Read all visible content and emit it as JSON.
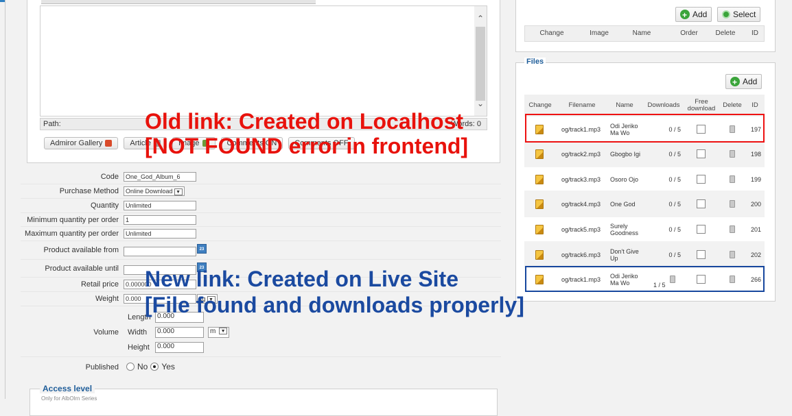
{
  "editor": {
    "path_label": "Path:",
    "words_label": "Words: 0",
    "buttons": [
      "Admiror Gallery",
      "Article",
      "Image",
      "Comments ON",
      "Comments OFF"
    ]
  },
  "form": {
    "code": {
      "label": "Code",
      "value": "One_God_Album_6"
    },
    "purchase_method": {
      "label": "Purchase Method",
      "value": "Online Download"
    },
    "quantity": {
      "label": "Quantity",
      "value": "Unlimited"
    },
    "min_qty": {
      "label": "Minimum quantity per order",
      "value": "1"
    },
    "max_qty": {
      "label": "Maximum quantity per order",
      "value": "Unlimited"
    },
    "avail_from": {
      "label": "Product available from",
      "value": ""
    },
    "avail_until": {
      "label": "Product available until",
      "value": ""
    },
    "retail_price": {
      "label": "Retail price",
      "value": "0.000000"
    },
    "weight": {
      "label": "Weight",
      "value": "0.000",
      "unit": "kg"
    },
    "volume": {
      "label": "Volume",
      "length_label": "Length",
      "length": "0.000",
      "width_label": "Width",
      "width": "0.000",
      "unit": "m",
      "height_label": "Height",
      "height": "0.000"
    },
    "published": {
      "label": "Published",
      "no": "No",
      "yes": "Yes",
      "selected": "Yes"
    },
    "access_level": "Access level",
    "access_sub": "Only for AlbOlrn Series"
  },
  "images_panel": {
    "add_label": "Add",
    "select_label": "Select",
    "columns": [
      "Change",
      "Image",
      "Name",
      "Order",
      "Delete",
      "ID"
    ]
  },
  "files_panel": {
    "legend": "Files",
    "add_label": "Add",
    "columns": [
      "Change",
      "Filename",
      "Name",
      "Downloads",
      "Free download",
      "Delete",
      "ID"
    ],
    "rows": [
      {
        "filename": "og/track1.mp3",
        "name": "Odi Jeriko Ma Wo",
        "downloads": "0 / 5",
        "id": "197"
      },
      {
        "filename": "og/track2.mp3",
        "name": "Gbogbo Igi",
        "downloads": "0 / 5",
        "id": "198"
      },
      {
        "filename": "og/track3.mp3",
        "name": "Osoro Ojo",
        "downloads": "0 / 5",
        "id": "199"
      },
      {
        "filename": "og/track4.mp3",
        "name": "One God",
        "downloads": "0 / 5",
        "id": "200"
      },
      {
        "filename": "og/track5.mp3",
        "name": "Surely Goodness",
        "downloads": "0 / 5",
        "id": "201"
      },
      {
        "filename": "og/track6.mp3",
        "name": "Don't Give Up",
        "downloads": "0 / 5",
        "id": "202"
      },
      {
        "filename": "og/track1.mp3",
        "name": "Odi Jeriko Ma Wo",
        "downloads": "1 / 5",
        "id": "266"
      }
    ]
  },
  "annotations": {
    "old_line1": "Old link: Created on Localhost",
    "old_line2": "[NOT FOUND error in frontend]",
    "new_line1": "New link: Created on Live Site",
    "new_line2": "[File found and downloads properly]",
    "old_color": "#e8120c",
    "new_color": "#1b4aa0"
  }
}
